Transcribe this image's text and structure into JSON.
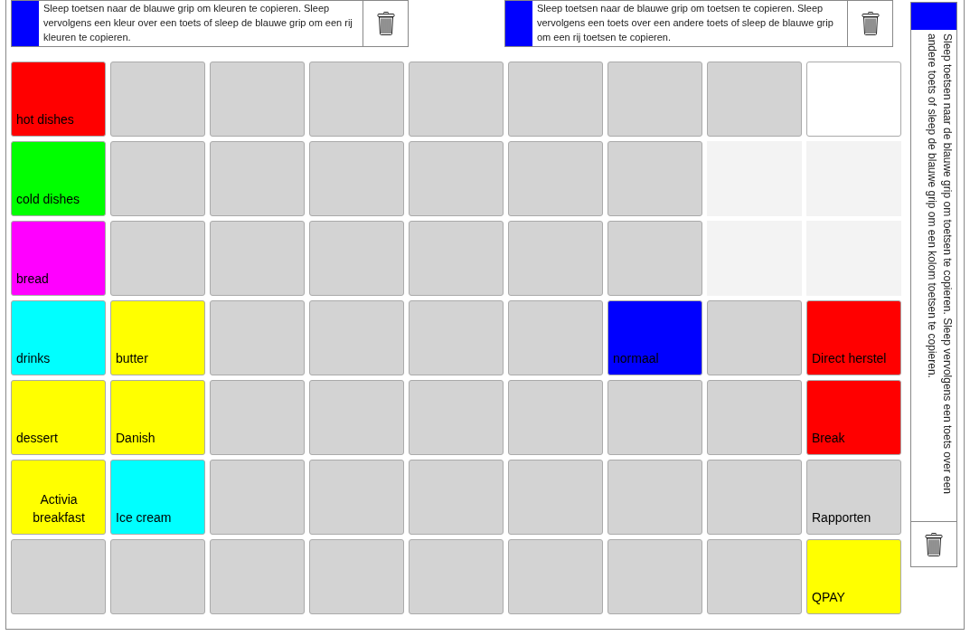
{
  "copy_bars": [
    {
      "text": "Sleep toetsen naar de blauwe grip om kleuren te copieren. Sleep vervolgens een kleur over een toets of sleep de blauwe grip om een rij kleuren te copieren."
    },
    {
      "text": "Sleep toetsen naar de blauwe grip om toetsen te copieren. Sleep vervolgens een toets over een andere toets of sleep de blauwe grip om een rij toetsen te copieren."
    }
  ],
  "side_panel": {
    "text": "Sleep toetsen naar de blauwe grip om toetsen te copieren. Sleep vervolgens een toets over een andere toets of sleep de blauwe grip om een kolom toetsen te copieren."
  },
  "grid": {
    "rows": [
      [
        {
          "kind": "key",
          "color": "#ff0000",
          "label": "hot dishes"
        },
        {
          "kind": "key",
          "color": "#d3d3d3"
        },
        {
          "kind": "key",
          "color": "#d3d3d3"
        },
        {
          "kind": "key",
          "color": "#d3d3d3"
        },
        {
          "kind": "key",
          "color": "#d3d3d3"
        },
        {
          "kind": "key",
          "color": "#d3d3d3"
        },
        {
          "kind": "key",
          "color": "#d3d3d3"
        },
        {
          "kind": "key",
          "color": "#d3d3d3"
        },
        {
          "kind": "key",
          "color": "#ffffff"
        }
      ],
      [
        {
          "kind": "key",
          "color": "#00ff00",
          "label": "cold dishes"
        },
        {
          "kind": "key",
          "color": "#d3d3d3"
        },
        {
          "kind": "key",
          "color": "#d3d3d3"
        },
        {
          "kind": "key",
          "color": "#d3d3d3"
        },
        {
          "kind": "key",
          "color": "#d3d3d3"
        },
        {
          "kind": "key",
          "color": "#d3d3d3"
        },
        {
          "kind": "key",
          "color": "#d3d3d3"
        },
        {
          "kind": "empty"
        },
        {
          "kind": "empty"
        }
      ],
      [
        {
          "kind": "key",
          "color": "#ff00ff",
          "label": "bread"
        },
        {
          "kind": "key",
          "color": "#d3d3d3"
        },
        {
          "kind": "key",
          "color": "#d3d3d3"
        },
        {
          "kind": "key",
          "color": "#d3d3d3"
        },
        {
          "kind": "key",
          "color": "#d3d3d3"
        },
        {
          "kind": "key",
          "color": "#d3d3d3"
        },
        {
          "kind": "key",
          "color": "#d3d3d3"
        },
        {
          "kind": "empty"
        },
        {
          "kind": "empty"
        }
      ],
      [
        {
          "kind": "key",
          "color": "#00ffff",
          "label": "drinks"
        },
        {
          "kind": "key",
          "color": "#ffff00",
          "label": "butter"
        },
        {
          "kind": "key",
          "color": "#d3d3d3"
        },
        {
          "kind": "key",
          "color": "#d3d3d3"
        },
        {
          "kind": "key",
          "color": "#d3d3d3"
        },
        {
          "kind": "key",
          "color": "#d3d3d3"
        },
        {
          "kind": "key",
          "color": "#0000ff",
          "label": "normaal"
        },
        {
          "kind": "key",
          "color": "#d3d3d3"
        },
        {
          "kind": "key",
          "color": "#ff0000",
          "label": "Direct herstel"
        }
      ],
      [
        {
          "kind": "key",
          "color": "#ffff00",
          "label": "dessert"
        },
        {
          "kind": "key",
          "color": "#ffff00",
          "label": "Danish"
        },
        {
          "kind": "key",
          "color": "#d3d3d3"
        },
        {
          "kind": "key",
          "color": "#d3d3d3"
        },
        {
          "kind": "key",
          "color": "#d3d3d3"
        },
        {
          "kind": "key",
          "color": "#d3d3d3"
        },
        {
          "kind": "key",
          "color": "#d3d3d3"
        },
        {
          "kind": "key",
          "color": "#d3d3d3"
        },
        {
          "kind": "key",
          "color": "#ff0000",
          "label": "Break"
        }
      ],
      [
        {
          "kind": "centered",
          "color": "#ffff00",
          "label": "Activia breakfast"
        },
        {
          "kind": "key",
          "color": "#00ffff",
          "label": "Ice cream"
        },
        {
          "kind": "key",
          "color": "#d3d3d3"
        },
        {
          "kind": "key",
          "color": "#d3d3d3"
        },
        {
          "kind": "key",
          "color": "#d3d3d3"
        },
        {
          "kind": "key",
          "color": "#d3d3d3"
        },
        {
          "kind": "key",
          "color": "#d3d3d3"
        },
        {
          "kind": "key",
          "color": "#d3d3d3"
        },
        {
          "kind": "key",
          "color": "#d3d3d3",
          "label": "Rapporten"
        }
      ],
      [
        {
          "kind": "key",
          "color": "#d3d3d3"
        },
        {
          "kind": "key",
          "color": "#d3d3d3"
        },
        {
          "kind": "key",
          "color": "#d3d3d3"
        },
        {
          "kind": "key",
          "color": "#d3d3d3"
        },
        {
          "kind": "key",
          "color": "#d3d3d3"
        },
        {
          "kind": "key",
          "color": "#d3d3d3"
        },
        {
          "kind": "key",
          "color": "#d3d3d3"
        },
        {
          "kind": "key",
          "color": "#d3d3d3"
        },
        {
          "kind": "key",
          "color": "#ffff00",
          "label": "QPAY"
        }
      ]
    ]
  }
}
